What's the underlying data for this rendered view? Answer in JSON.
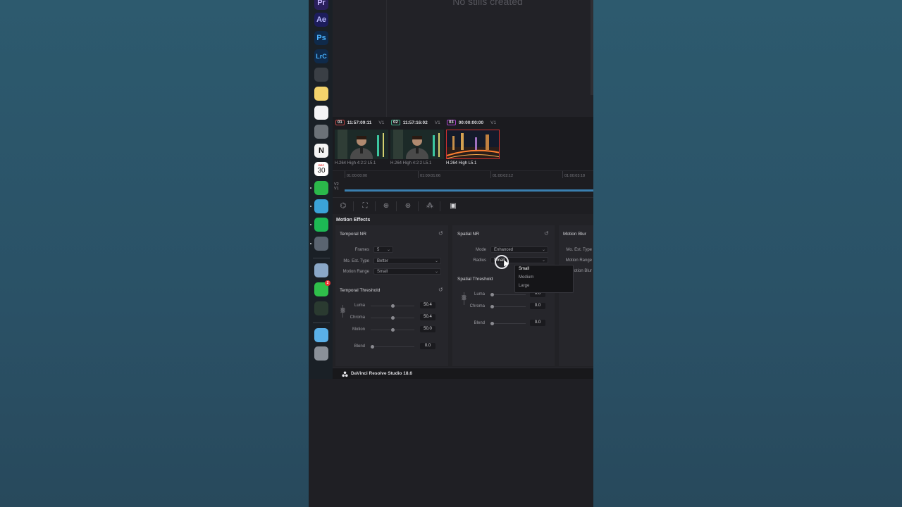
{
  "dock": {
    "items": [
      {
        "name": "premiere-pro-icon",
        "label": "Pr",
        "color": "#2a1f5c",
        "fg": "#c7b8ff"
      },
      {
        "name": "after-effects-icon",
        "label": "Ae",
        "color": "#1d1d5c",
        "fg": "#b8b8ff"
      },
      {
        "name": "photoshop-icon",
        "label": "Ps",
        "color": "#0f2a4a",
        "fg": "#49b3ff"
      },
      {
        "name": "lightroom-classic-icon",
        "label": "LrC",
        "color": "#0f2a4a",
        "fg": "#49b3ff"
      },
      {
        "name": "davinci-resolve-icon",
        "label": "",
        "color": "#3a3f45",
        "fg": "#cfd5da"
      },
      {
        "name": "notes-icon",
        "label": "",
        "color": "#f3d36b",
        "fg": "#fff"
      },
      {
        "name": "freeform-icon",
        "label": "",
        "color": "#f4f4f6",
        "fg": "#3a7fd0"
      },
      {
        "name": "system-settings-icon",
        "label": "",
        "color": "#6c7278",
        "fg": "#fff"
      },
      {
        "name": "notion-icon",
        "label": "N",
        "color": "#f5f5f5",
        "fg": "#111"
      },
      {
        "name": "calendar-icon",
        "label": "30",
        "month": "DEC",
        "color": "#ffffff",
        "fg": "#222"
      },
      {
        "name": "whatsapp-icon",
        "label": "",
        "color": "#2bb84a",
        "fg": "#fff"
      },
      {
        "name": "safari-icon",
        "label": "",
        "color": "#3ba3d8",
        "fg": "#fff"
      },
      {
        "name": "spotify-icon",
        "label": "",
        "color": "#1db954",
        "fg": "#111"
      },
      {
        "name": "quicktime-icon",
        "label": "",
        "color": "#5a6470",
        "fg": "#fff"
      },
      {
        "name": "preview-icon",
        "label": "",
        "color": "#8aa8c8",
        "fg": "#fff"
      },
      {
        "name": "facetime-icon",
        "label": "",
        "color": "#2fbf4a",
        "fg": "#fff",
        "badge": "2"
      },
      {
        "name": "activity-monitor-icon",
        "label": "",
        "color": "#2a3a30",
        "fg": "#4cd964"
      },
      {
        "name": "folder-icon",
        "label": "",
        "color": "#5ab0e8",
        "fg": "#fff"
      },
      {
        "name": "trash-icon",
        "label": "",
        "color": "#8a9098",
        "fg": "#fff"
      }
    ]
  },
  "gallery": {
    "empty_text": "No stills created"
  },
  "clips": [
    {
      "num": "01",
      "timecode": "11:57:09:11",
      "track": "V1",
      "codec": "H.264 High 4:2:2 L5.1"
    },
    {
      "num": "02",
      "timecode": "11:57:16:02",
      "track": "V1",
      "codec": "H.264 High 4:2:2 L5.1"
    },
    {
      "num": "03",
      "timecode": "00:00:00:00",
      "track": "V1",
      "codec": "H.264 High L5.1"
    }
  ],
  "ruler": {
    "ticks": [
      "01:00:00:00",
      "01:00:01:06",
      "01:00:02:12",
      "01:00:03:18"
    ],
    "tracks": [
      "V2",
      "V1"
    ]
  },
  "panel": {
    "title": "Motion Effects",
    "temporal_nr": {
      "title": "Temporal NR",
      "frames_label": "Frames",
      "frames_value": "5",
      "mo_est_label": "Mo. Est. Type",
      "mo_est_value": "Better",
      "motion_range_label": "Motion Range",
      "motion_range_value": "Small"
    },
    "temporal_threshold": {
      "title": "Temporal Threshold",
      "luma_label": "Luma",
      "luma_value": "50.4",
      "luma_pos": 0.5,
      "chroma_label": "Chroma",
      "chroma_value": "50.4",
      "chroma_pos": 0.5,
      "motion_label": "Motion",
      "motion_value": "50.0",
      "motion_pos": 0.5,
      "blend_label": "Blend",
      "blend_value": "0.0",
      "blend_pos": 0
    },
    "spatial_nr": {
      "title": "Spatial NR",
      "mode_label": "Mode",
      "mode_value": "Enhanced",
      "radius_label": "Radius",
      "radius_value": "Small"
    },
    "spatial_threshold": {
      "title": "Spatial Threshold",
      "luma_label": "Luma",
      "luma_value": "0.0",
      "chroma_label": "Chroma",
      "chroma_value": "0.0",
      "blend_label": "Blend",
      "blend_value": "0.0"
    },
    "motion_blur": {
      "title": "Motion Blur",
      "mo_est_label": "Mo. Est. Type",
      "motion_range_label": "Motion Range",
      "motion_blur_label": "Motion Blur"
    },
    "radius_dropdown": {
      "options": [
        "Small",
        "Medium",
        "Large"
      ],
      "selected": "Small"
    }
  },
  "status": {
    "app_name": "DaVinci Resolve Studio 18.6"
  }
}
